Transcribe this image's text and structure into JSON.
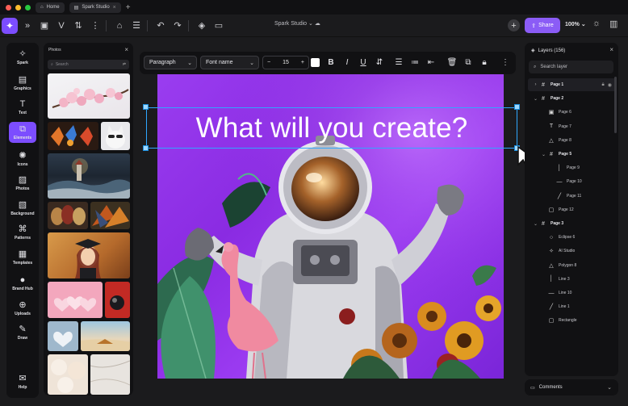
{
  "window": {
    "tabs": [
      {
        "label": "Home"
      },
      {
        "label": "Spark Studio"
      }
    ]
  },
  "topbar": {
    "doc_title": "Spark Studio",
    "share_label": "Share",
    "zoom": "100%"
  },
  "rail": {
    "items": [
      {
        "label": "Spark",
        "icon": "sparkle-icon"
      },
      {
        "label": "Graphics",
        "icon": "graphics-icon"
      },
      {
        "label": "Text",
        "icon": "text-icon"
      },
      {
        "label": "Elements",
        "icon": "elements-icon",
        "active": true
      },
      {
        "label": "Icons",
        "icon": "icons-icon"
      },
      {
        "label": "Photos",
        "icon": "photos-icon"
      },
      {
        "label": "Background",
        "icon": "background-icon"
      },
      {
        "label": "Patterns",
        "icon": "patterns-icon"
      },
      {
        "label": "Templates",
        "icon": "templates-icon"
      },
      {
        "label": "Brand Hub",
        "icon": "brand-hub-icon"
      },
      {
        "label": "Uploads",
        "icon": "uploads-icon"
      },
      {
        "label": "Draw",
        "icon": "draw-icon"
      },
      {
        "label": "Help",
        "icon": "help-icon"
      }
    ]
  },
  "photos_panel": {
    "title": "Photos",
    "search_placeholder": "Search"
  },
  "format_bar": {
    "paragraph": "Paragraph",
    "font": "Font name",
    "font_size": "15",
    "text_color": "#ffffff"
  },
  "canvas": {
    "headline": "What will you create?",
    "background_color": "#8f34ea"
  },
  "layers_panel": {
    "title": "Layers (156)",
    "search_placeholder": "Search layer",
    "rows": [
      {
        "label": "Page 1",
        "level": 0,
        "icon": "frame-icon",
        "bold": true,
        "chevron": ">",
        "selected": true,
        "tail": "lock-eye"
      },
      {
        "label": "Page 2",
        "level": 0,
        "icon": "frame-icon",
        "bold": true,
        "chevron": "v"
      },
      {
        "label": "Page 6",
        "level": 1,
        "icon": "image-icon"
      },
      {
        "label": "Page 7",
        "level": 1,
        "icon": "text-icon"
      },
      {
        "label": "Page 8",
        "level": 1,
        "icon": "triangle-icon"
      },
      {
        "label": "Page 5",
        "level": 1,
        "icon": "frame-icon",
        "bold": true,
        "chevron": "v"
      },
      {
        "label": "Page 9",
        "level": 2,
        "icon": "line-icon"
      },
      {
        "label": "Page 10",
        "level": 2,
        "icon": "dash-icon"
      },
      {
        "label": "Page 11",
        "level": 2,
        "icon": "slash-icon"
      },
      {
        "label": "Page 12",
        "level": 1,
        "icon": "square-icon"
      },
      {
        "label": "Page 3",
        "level": 0,
        "icon": "frame-icon",
        "bold": true,
        "chevron": "v"
      },
      {
        "label": "Eclipse 6",
        "level": 1,
        "icon": "circle-icon"
      },
      {
        "label": "AI Studio",
        "level": 1,
        "icon": "sparkle-icon"
      },
      {
        "label": "Polygon 8",
        "level": 1,
        "icon": "triangle-icon"
      },
      {
        "label": "Line 3",
        "level": 1,
        "icon": "line-icon"
      },
      {
        "label": "Line 10",
        "level": 1,
        "icon": "dash-icon"
      },
      {
        "label": "Line 1",
        "level": 1,
        "icon": "slash-icon"
      },
      {
        "label": "Rectangle",
        "level": 1,
        "icon": "square-icon"
      }
    ]
  },
  "comments": {
    "label": "Comments"
  }
}
